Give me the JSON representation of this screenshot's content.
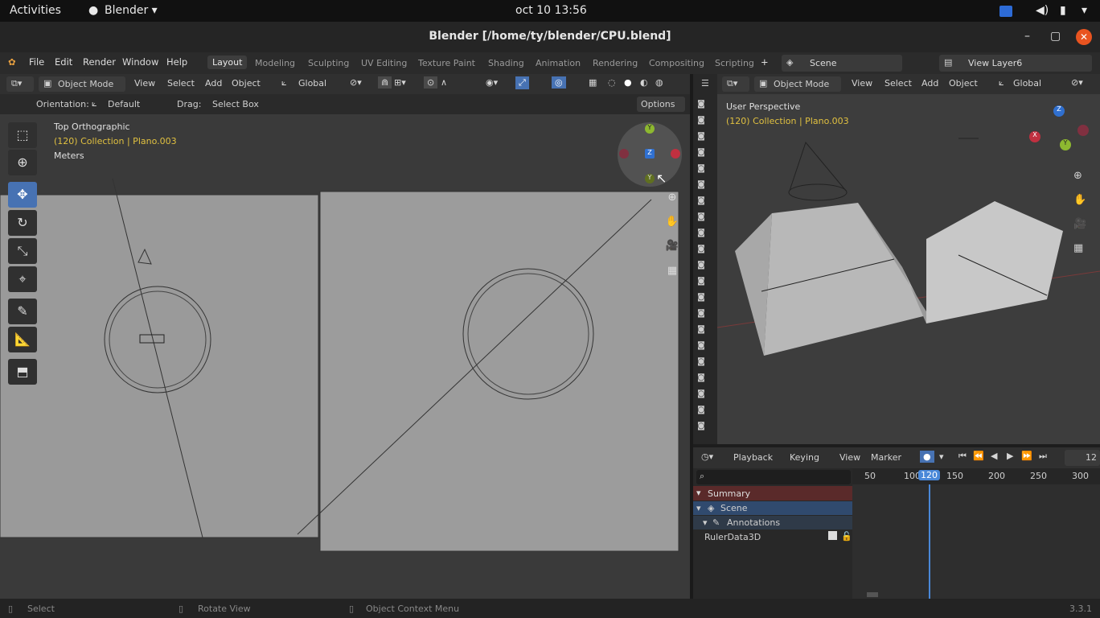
{
  "os": {
    "activities": "Activities",
    "app_menu": "Blender ▾",
    "clock": "oct 10  13:56"
  },
  "window": {
    "title": "Blender [/home/ty/blender/CPU.blend]",
    "minimize": "–",
    "maximize": "▢",
    "close": "✕"
  },
  "menu": {
    "file": "File",
    "edit": "Edit",
    "render": "Render",
    "window": "Window",
    "help": "Help",
    "workspaces": [
      "Layout",
      "Modeling",
      "Sculpting",
      "UV Editing",
      "Texture Paint",
      "Shading",
      "Animation",
      "Rendering",
      "Compositing",
      "Scripting"
    ],
    "add_ws": "+",
    "scene": "Scene",
    "view_layer": "View Layer6"
  },
  "left_vp": {
    "mode": "Object Mode",
    "view": "View",
    "select": "Select",
    "add": "Add",
    "object": "Object",
    "transform": "Global",
    "orientation_label": "Orientation:",
    "orientation_value": "Default",
    "drag_label": "Drag:",
    "drag_value": "Select Box",
    "options": "Options",
    "overlay_title": "Top Orthographic",
    "overlay_collection": "(120) Collection | Plano.003",
    "overlay_units": "Meters"
  },
  "gizmo_left": {
    "y": "Y",
    "z": "Z",
    "neg_y": "Y"
  },
  "right_vp": {
    "mode": "Object Mode",
    "view": "View",
    "select": "Select",
    "add": "Add",
    "object": "Object",
    "transform": "Global",
    "overlay_title": "User Perspective",
    "overlay_collection": "(120) Collection | Plano.003"
  },
  "gizmo_right": {
    "x": "X",
    "y": "Y",
    "z": "Z"
  },
  "timeline": {
    "playback": "Playback",
    "keying": "Keying",
    "view": "View",
    "marker": "Marker",
    "frame": "12",
    "ticks": [
      "50",
      "100",
      "120",
      "150",
      "200",
      "250",
      "300"
    ],
    "current": "120"
  },
  "dopesheet": {
    "summary": "Summary",
    "scene": "Scene",
    "annotations": "Annotations",
    "ruler": "RulerData3D"
  },
  "status": {
    "select": "Select",
    "rotate": "Rotate View",
    "context": "Object Context Menu",
    "version": "3.3.1"
  },
  "colors": {
    "accent": "#4772b3",
    "active_frame": "#4a88d8",
    "summary_bg": "#5a2a2a"
  }
}
